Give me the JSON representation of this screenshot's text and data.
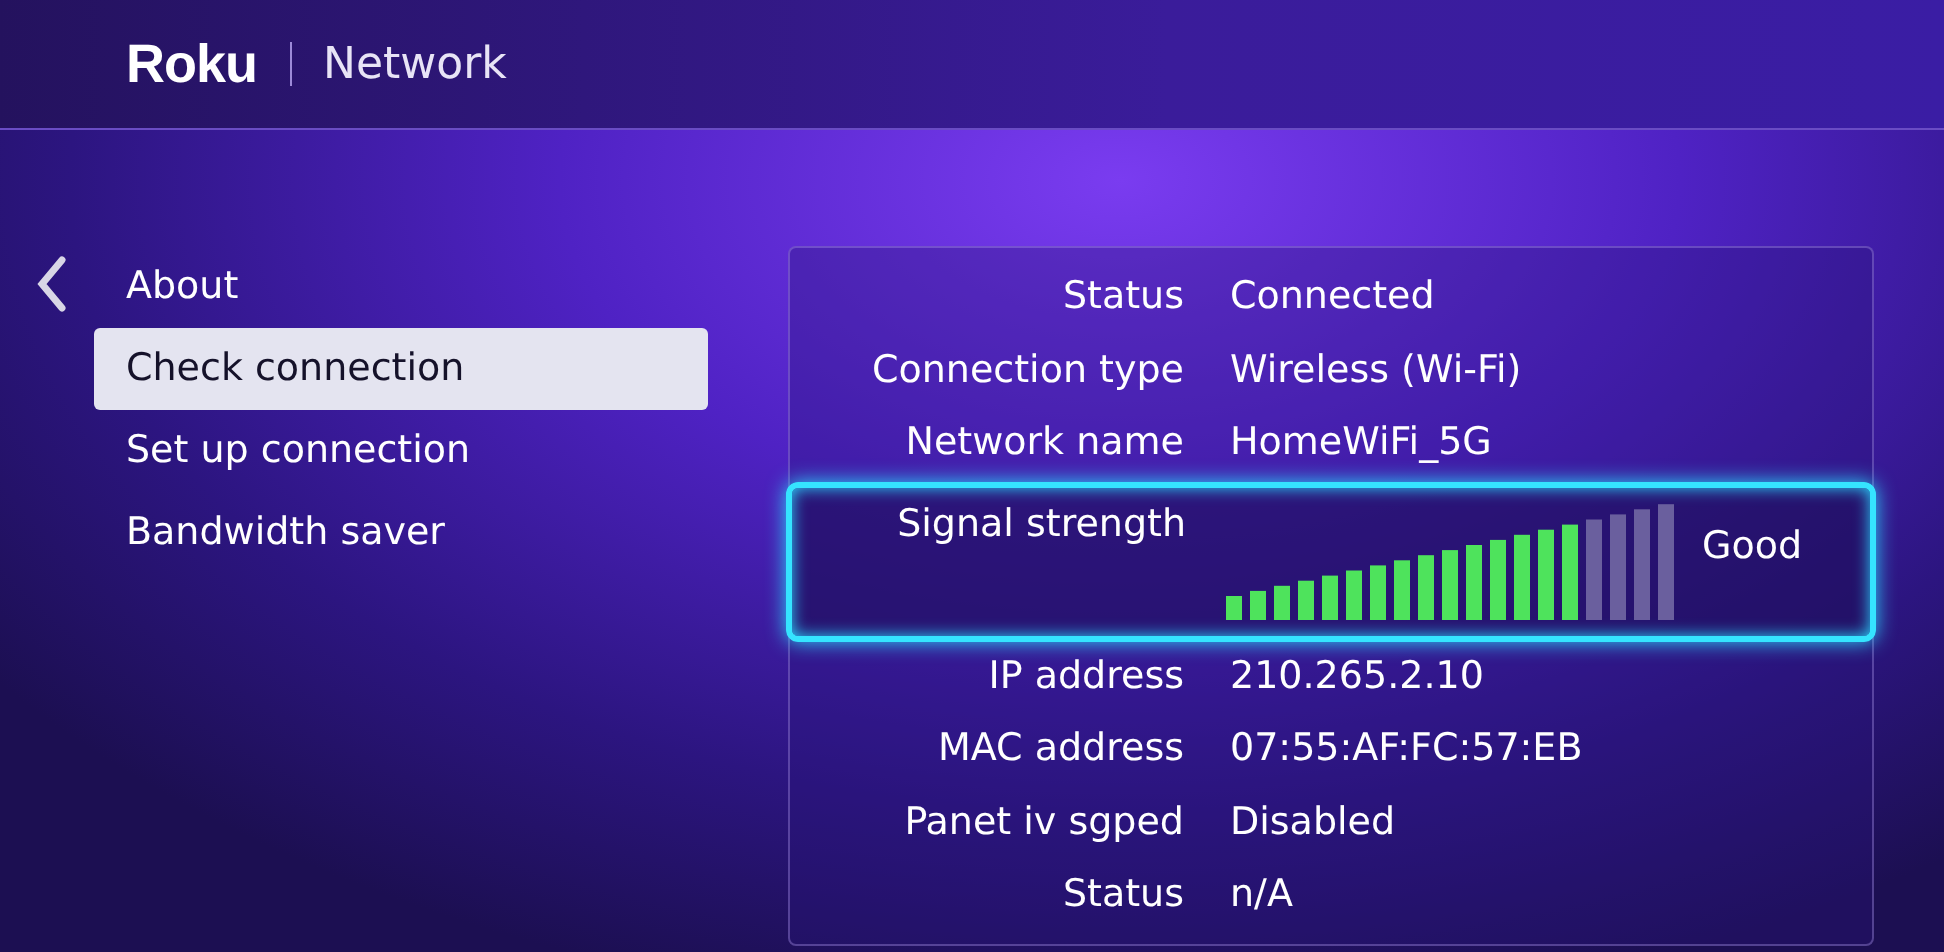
{
  "header": {
    "logo": "Roku",
    "title": "Network"
  },
  "menu": [
    {
      "label": "About",
      "selected": false
    },
    {
      "label": "Check connection",
      "selected": true
    },
    {
      "label": "Set up connection",
      "selected": false
    },
    {
      "label": "Bandwidth saver",
      "selected": false
    }
  ],
  "details": [
    {
      "kind": "info",
      "label": "Status",
      "value": "Connected",
      "focused": false
    },
    {
      "kind": "info",
      "label": "Connection type",
      "value": "Wireless (Wi-Fi)",
      "focused": false
    },
    {
      "kind": "info",
      "label": "Network name",
      "value": "HomeWiFi_5G",
      "focused": false
    },
    {
      "kind": "signal",
      "label": "Signal strength",
      "level": 0.79,
      "value": "Good",
      "focused": true
    },
    {
      "kind": "info",
      "label": "IP address",
      "value": "210.265.2.10",
      "focused": false
    },
    {
      "kind": "info",
      "label": "MAC address",
      "value": "07:55:AF:FC:57:EB",
      "focused": false
    },
    {
      "kind": "info",
      "label": "Panet iv sgped",
      "value": "Disabled",
      "focused": false
    },
    {
      "kind": "info",
      "label": "Status",
      "value": "n/A",
      "focused": false
    }
  ]
}
